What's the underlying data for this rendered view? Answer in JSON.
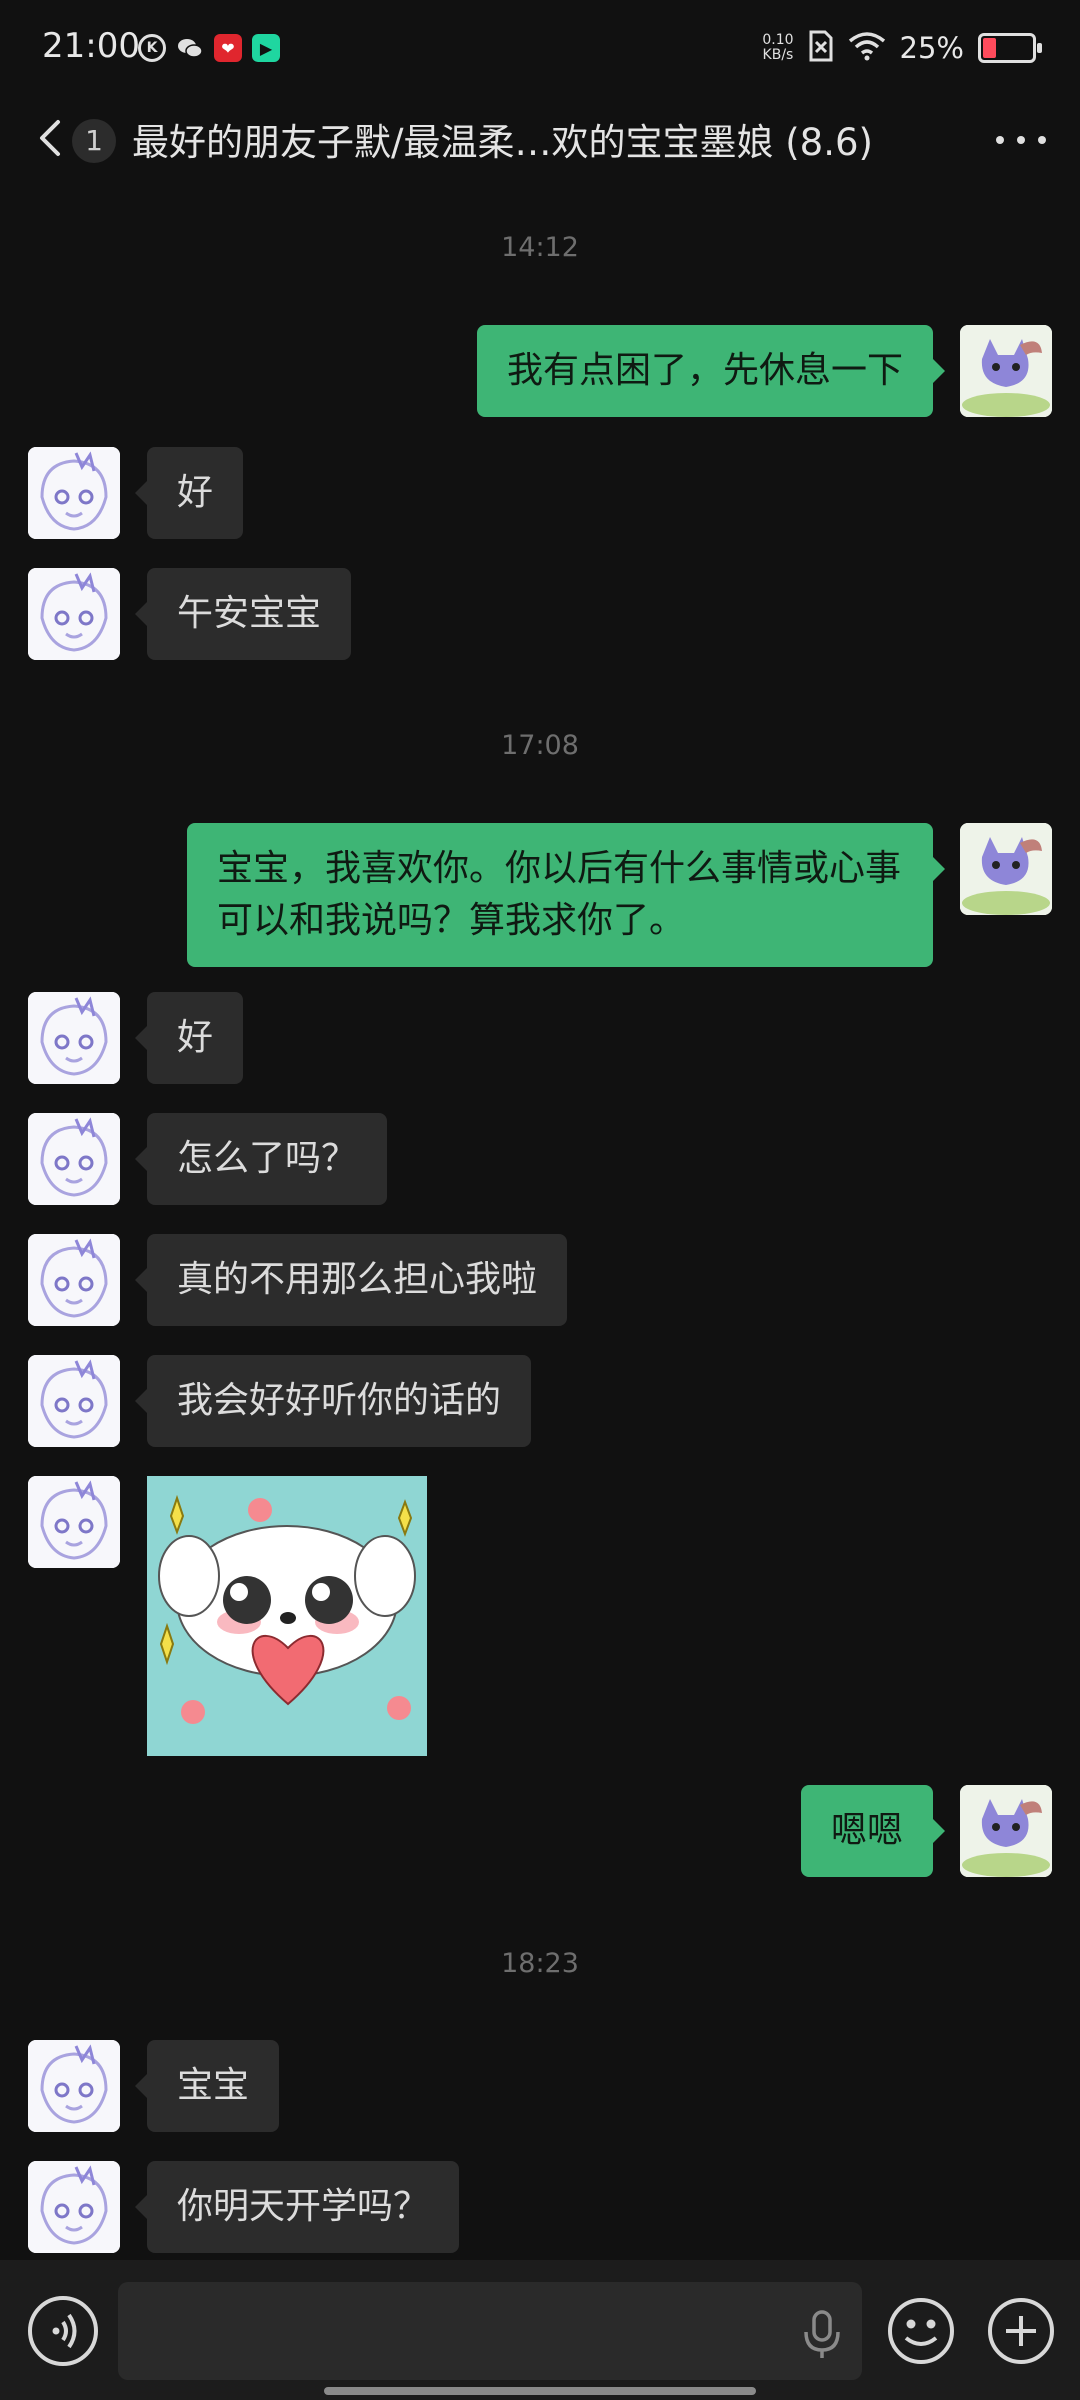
{
  "status_bar": {
    "time": "21:00",
    "net_speed_value": "0.10",
    "net_speed_unit": "KB/s",
    "battery_percent": "25%",
    "battery_level": 0.25,
    "icons": [
      "k-icon",
      "wechat-icon",
      "app-red-icon",
      "app-green-icon",
      "sim-x-icon",
      "wifi-icon",
      "battery-icon"
    ]
  },
  "nav": {
    "unread_count": "1",
    "title": "最好的朋友子默/最温柔…欢的宝宝墨娘 (8.6)"
  },
  "chat": {
    "timestamps": [
      "14:12",
      "17:08",
      "18:23"
    ],
    "messages": [
      {
        "side": "right",
        "text": "我有点困了，先休息一下"
      },
      {
        "side": "left",
        "text": "好"
      },
      {
        "side": "left",
        "text": "午安宝宝"
      },
      {
        "side": "right",
        "text": "宝宝，我喜欢你。你以后有什么事情或心事可以和我说吗？算我求你了。"
      },
      {
        "side": "left",
        "text": "好"
      },
      {
        "side": "left",
        "text": "怎么了吗？"
      },
      {
        "side": "left",
        "text": "真的不用那么担心我啦"
      },
      {
        "side": "left",
        "text": "我会好好听你的话的"
      },
      {
        "side": "left",
        "type": "sticker",
        "icon": "puppy-heart-sticker"
      },
      {
        "side": "right",
        "text": "嗯嗯"
      },
      {
        "side": "left",
        "text": "宝宝"
      },
      {
        "side": "left",
        "text": "你明天开学吗？"
      }
    ]
  },
  "input": {
    "value": "",
    "icons": [
      "voice-icon",
      "mic-icon",
      "emoji-icon",
      "plus-icon"
    ]
  },
  "colors": {
    "background": "#111111",
    "bubble_left": "#2c2c2c",
    "bubble_right": "#3eb575",
    "battery_low": "#ff4b5c"
  }
}
